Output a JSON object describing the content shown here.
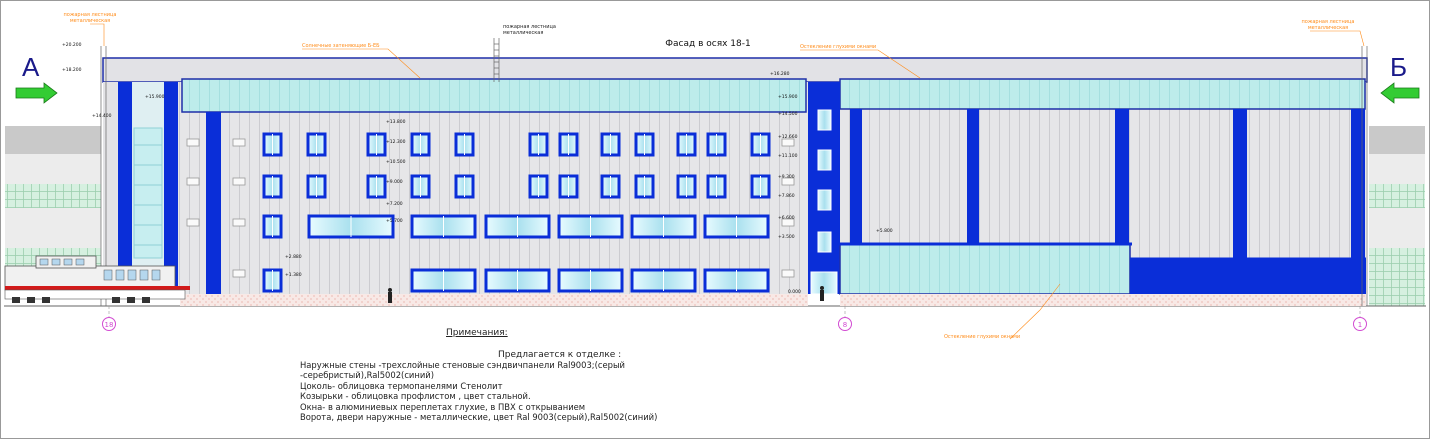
{
  "title": "Фасад в осях 18-1",
  "section_labels": {
    "left": "А",
    "right": "Б"
  },
  "callouts": {
    "fire_ladder_left": [
      "пожарная лестница",
      "металлическая"
    ],
    "fire_ladder_mid": [
      "пожарная лестница",
      "металлическая"
    ],
    "fire_ladder_right": [
      "пожарная лестница",
      "металлическая"
    ],
    "canopy": "Солнечные затеняющие Б-ЕБ",
    "glazing_top": "Остекление глухими окнами",
    "glazing_bottom": "Остекление глухими окнами"
  },
  "elevations": {
    "m20200": "+20.200",
    "m18200": "+18.200",
    "m16280": "+16.280",
    "m15900a": "+15.900",
    "m15900b": "+15.900",
    "m14400": "+14.400",
    "m14500": "+14.500",
    "m13800": "+13.800",
    "m12300": "+12.300",
    "m12660": "+12.660",
    "m11100": "+11.100",
    "m10500": "+10.500",
    "m9000": "+9.000",
    "m9300": "+9.300",
    "m7860": "+7.860",
    "m7200": "+7.200",
    "m6600": "+6.600",
    "m5700": "+5.700",
    "m5800": "+5.800",
    "m3500": "+3.500",
    "m2880": "+2.880",
    "m1380": "+1.380",
    "m0000": "0.000"
  },
  "axes": [
    "18",
    "8",
    "1"
  ],
  "notes": {
    "heading": "Примечания:",
    "subheading": "Предлагается к отделке  :",
    "lines": [
      "Наружные стены -трехслойные стеновые сэндвичпанели Ral9003;(серый",
      "-серебристый),Ral5002(синий)",
      "Цоколь- облицовка  термопанелями Стенолит",
      "Козырьки - облицовка профлистом , цвет стальной.",
      "Окна- в алюминиевых переплетах глухие, в ПВХ с открыванием",
      "Ворота, двери наружные - металлические, цвет Ral 9003(серый),Ral5002(синий)"
    ]
  },
  "colors": {
    "blue": "#0a2ed8",
    "panel": "#e4e4e6",
    "glass": "#b7ecea",
    "plinth": "#f6e6e2",
    "green_arrow": "#33cc33",
    "annotation": "#ff8c1a",
    "axis_circle": "#d24bd2"
  }
}
